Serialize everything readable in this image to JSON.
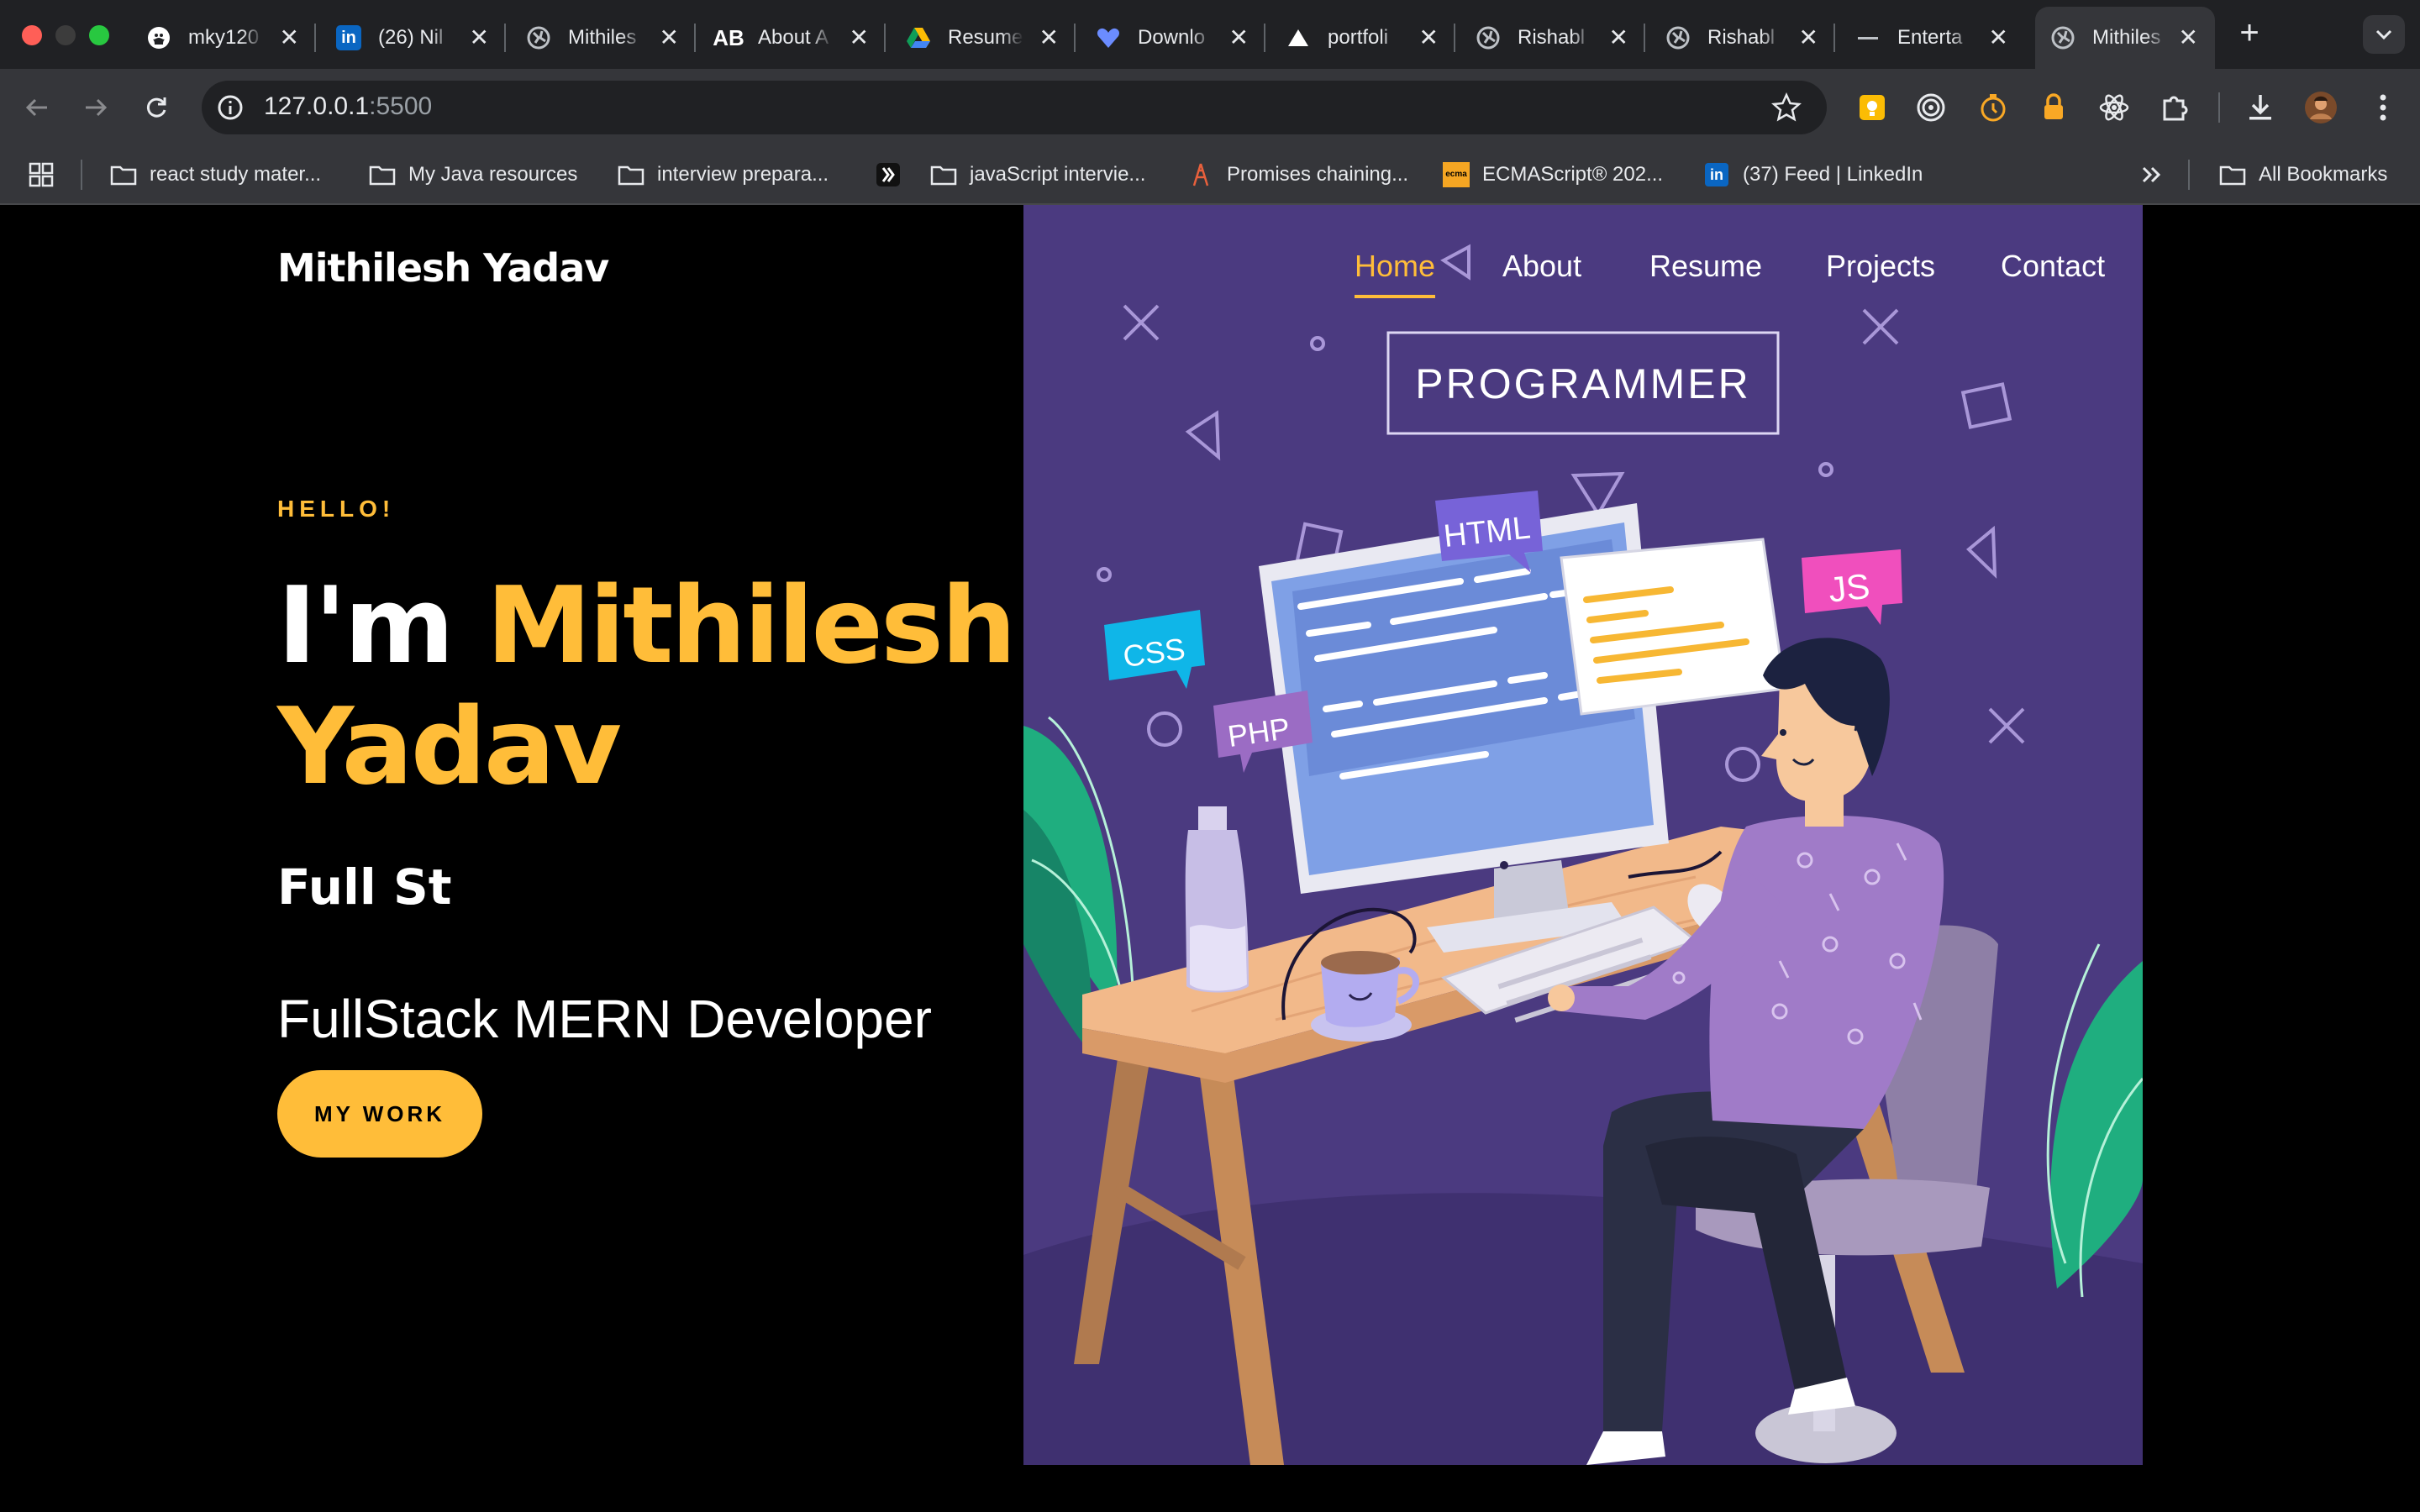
{
  "browser": {
    "tabs": [
      {
        "title": "mky120",
        "icon": "github-icon"
      },
      {
        "title": "(26) Nil",
        "icon": "linkedin-icon"
      },
      {
        "title": "Mithiles",
        "icon": "globe-icon"
      },
      {
        "title": "About A",
        "icon": "ab-logo-icon"
      },
      {
        "title": "Resume",
        "icon": "google-drive-icon"
      },
      {
        "title": "Downlo",
        "icon": "heart-icon"
      },
      {
        "title": "portfoli",
        "icon": "vercel-icon"
      },
      {
        "title": "Rishabl",
        "icon": "globe-icon"
      },
      {
        "title": "Rishabl",
        "icon": "globe-icon"
      },
      {
        "title": "Enterta",
        "icon": "dash-icon"
      },
      {
        "title": "Mithiles",
        "icon": "globe-icon"
      }
    ],
    "url_host": "127.0.0.1",
    "url_port": ":5500",
    "bookmarks": [
      {
        "label": "react study mater...",
        "icon": "folder-icon"
      },
      {
        "label": "My Java resources",
        "icon": "folder-icon"
      },
      {
        "label": "interview prepara...",
        "icon": "folder-icon"
      },
      {
        "label": "",
        "icon": "app-icon"
      },
      {
        "label": "javaScript intervie...",
        "icon": "folder-icon"
      },
      {
        "label": "Promises chaining...",
        "icon": "tower-icon"
      },
      {
        "label": "ECMAScript® 202...",
        "icon": "ecma-icon"
      },
      {
        "label": "(37) Feed | LinkedIn",
        "icon": "linkedin-icon"
      }
    ],
    "all_bookmarks": "All Bookmarks",
    "ecma_badge": "ecma",
    "linkedin_badge": "in"
  },
  "site": {
    "brand": "Mithilesh Yadav",
    "nav": [
      "Home",
      "About",
      "Resume",
      "Projects",
      "Contact"
    ],
    "hello": "HELLO!",
    "intro": "I'm",
    "first_name": "Mithilesh",
    "last_name": "Yadav",
    "typed": "Full St",
    "subtitle": "FullStack MERN Developer",
    "cta": "MY WORK"
  },
  "illustration": {
    "sign": "PROGRAMMER",
    "bubbles": [
      "HTML",
      "JS",
      "CSS",
      "PHP"
    ]
  },
  "colors": {
    "accent": "#ffbd39",
    "panel": "#4b3a80",
    "tabstrip": "#202124",
    "toolbar": "#35363a"
  }
}
